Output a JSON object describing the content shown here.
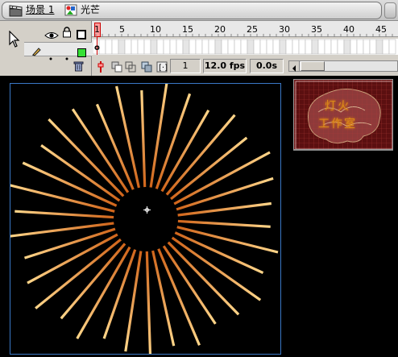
{
  "breadcrumb": {
    "scene_label": "场景 1",
    "symbol_label": "光芒"
  },
  "timeline": {
    "ruler_numbers": [
      "1",
      "5",
      "10",
      "15",
      "20",
      "25",
      "30",
      "35",
      "40",
      "45"
    ],
    "current_frame": "1",
    "frame_rate": "12.0 fps",
    "elapsed_time": "0.0s",
    "keyframe_marker": "o"
  },
  "library_preview": {
    "line1": "灯火",
    "line2": "工作室"
  },
  "colors": {
    "ray_start": "#cc5a10",
    "ray_end": "#ffd68a",
    "stage_border": "#3a78c6",
    "library_bg": "#5b0f10"
  }
}
